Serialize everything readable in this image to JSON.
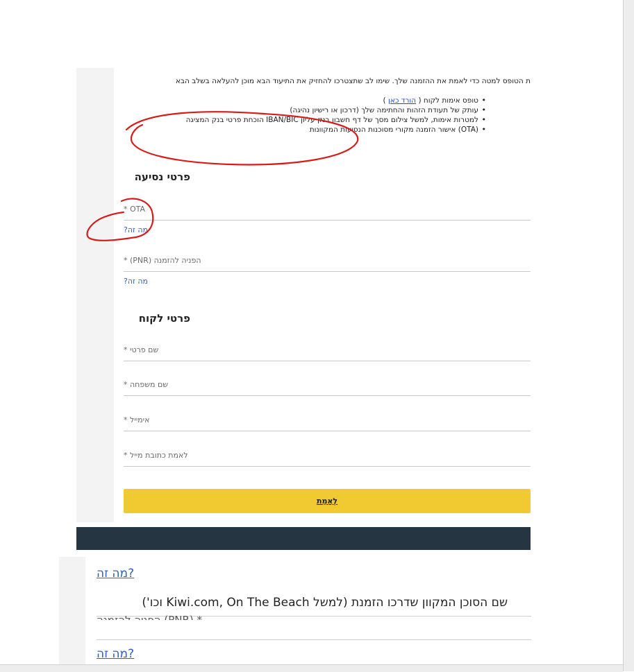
{
  "form": {
    "intro": "ת הטופס למטה כדי לאמת את ההזמנה שלך. שימו לב שתצטרכו להחזיק את התיעוד הבא מוכן להעלאה בשלב הבא",
    "bullets": [
      {
        "prefix": "טופס אימות לקוח ( ",
        "link": "הורד כאן",
        "suffix": " )"
      },
      {
        "text": "עותק של תעודת הזהות והחתימה שלך (דרכון או רישיון נהיגה)"
      },
      {
        "text": "למטרות אימות, למשל צילום מסך של דף חשבון בנק עליון IBAN/BIC הוכחת פרטי בנק המציגה"
      },
      {
        "text": "(OTA) אישור הזמנה מקורי מסוכנות הנסיעות המקוונות"
      }
    ],
    "trip_section_title": "פרטי נסיעה",
    "ota_label": "OTA *",
    "ota_help": "מה זה?",
    "pnr_label": "הפניה להזמנה (PNR) *",
    "pnr_help": "מה זה?",
    "customer_section_title": "פרטי לקוח",
    "first_name_label": "שם פרטי *",
    "last_name_label": "שם משפחה *",
    "email_label": "אימייל *",
    "confirm_email_label": "לאמת כתובת מייל *",
    "submit_label": "לְאַמֵת"
  },
  "zoom": {
    "help_link_top": "מה זה?",
    "ota_explanation": "שם הסוכן המקוון שדרכו הזמנת (למשל Kiwi.com, On The Beach וכו')",
    "pnr_label_partial": "הפניה להזמנה (PNR) *",
    "help_link_bottom": "מה זה?"
  },
  "colors": {
    "submit_yellow": "#f1c930",
    "footer_navy": "#253642",
    "link_blue": "#2c5fc9",
    "annotation_red": "#d71b1b"
  }
}
